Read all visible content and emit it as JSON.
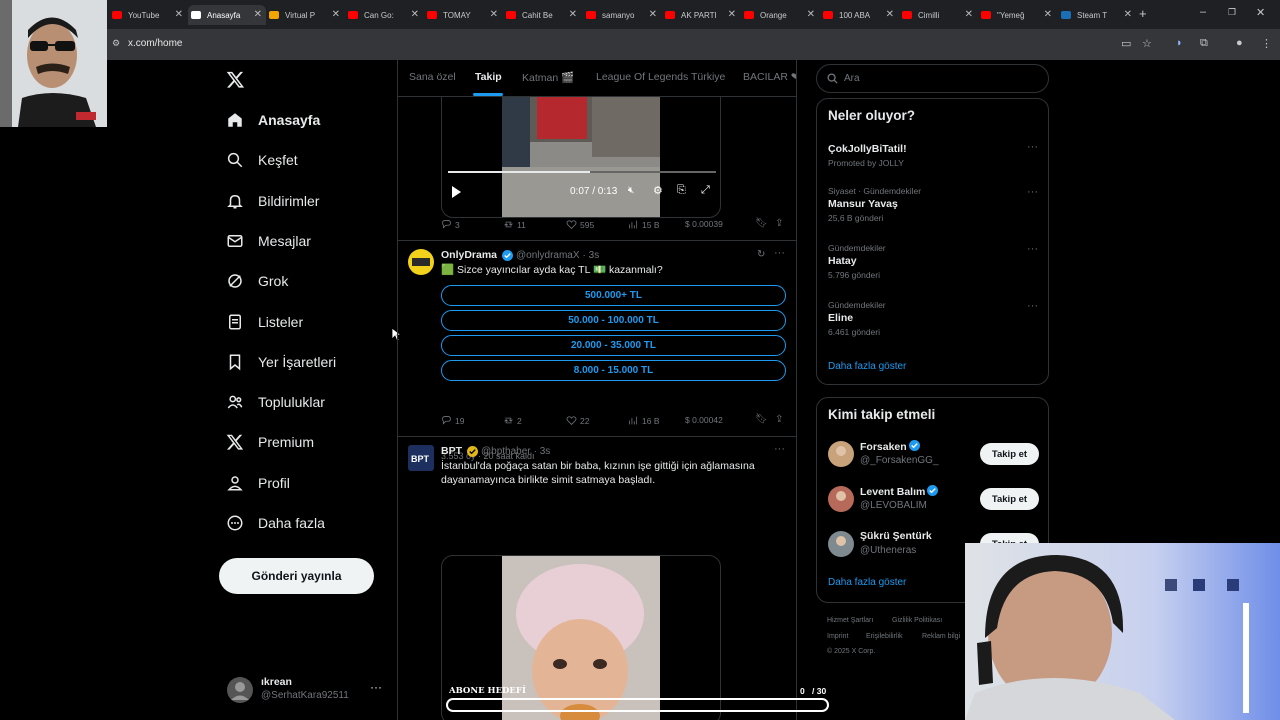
{
  "browser": {
    "tabs": [
      {
        "title": "YouTube",
        "color": "#ff0000"
      },
      {
        "title": "Anasayfa",
        "color": "#ffffff"
      },
      {
        "title": "Virtual P",
        "color": "#f4a400"
      },
      {
        "title": "Can Go:",
        "color": "#ff0000"
      },
      {
        "title": "TOMAY",
        "color": "#ff0000"
      },
      {
        "title": "Cahit Be",
        "color": "#ff0000"
      },
      {
        "title": "samanyo",
        "color": "#ff0000"
      },
      {
        "title": "AK PARTI",
        "color": "#ff0000"
      },
      {
        "title": "Orange",
        "color": "#ff0000"
      },
      {
        "title": "100 ABA",
        "color": "#ff0000"
      },
      {
        "title": "Cimilli",
        "color": "#ff0000"
      },
      {
        "title": "\"Yemeğ",
        "color": "#ff0000"
      },
      {
        "title": "Steam T",
        "color": "#1b6fb5"
      }
    ],
    "url": "x.com/home"
  },
  "nav": {
    "items": [
      {
        "label": "Anasayfa",
        "icon": "home-icon"
      },
      {
        "label": "Keşfet",
        "icon": "search-icon"
      },
      {
        "label": "Bildirimler",
        "icon": "bell-icon"
      },
      {
        "label": "Mesajlar",
        "icon": "mail-icon"
      },
      {
        "label": "Grok",
        "icon": "grok-icon"
      },
      {
        "label": "Listeler",
        "icon": "list-icon"
      },
      {
        "label": "Yer İşaretleri",
        "icon": "bookmark-icon"
      },
      {
        "label": "Topluluklar",
        "icon": "people-icon"
      },
      {
        "label": "Premium",
        "icon": "x-logo-icon"
      },
      {
        "label": "Profil",
        "icon": "person-icon"
      },
      {
        "label": "Daha fazla",
        "icon": "more-circle-icon"
      }
    ],
    "post_button": "Gönderi yayınla",
    "account": {
      "name": "ıkrean",
      "handle": "@SerhatKara92511"
    }
  },
  "feed": {
    "tabs": [
      "Sana özel",
      "Takip",
      "Katman 🎬",
      "League Of Legends Türkiye",
      "BACILAR ❤"
    ],
    "video1": {
      "time": "0:07 / 0:13",
      "progress": 0.53
    },
    "post1_stats": {
      "replies": "3",
      "reposts": "11",
      "likes": "595",
      "views": "15 B",
      "tips": "$ 0.00039"
    },
    "post2": {
      "name": "OnlyDrama",
      "handle": "@onlydramaX",
      "time": "· 3s",
      "text": "🟩 Sizce yayıncılar ayda kaç TL 💵 kazanmalı?",
      "poll": [
        "500.000+ TL",
        "50.000 - 100.000 TL",
        "20.000 - 35.000 TL",
        "8.000 - 15.000 TL"
      ],
      "poll_meta": "3.553 oy · 20 saat kaldı",
      "stats": {
        "replies": "19",
        "reposts": "2",
        "likes": "22",
        "views": "16 B",
        "tips": "$ 0.00042"
      }
    },
    "post3": {
      "name": "BPT",
      "handle": "@bpthaber",
      "time": "· 3s",
      "text": "İstanbul'da poğaça satan bir baba, kızının işe gittiği için ağlamasına dayanamayınca birlikte simit satmaya başladı."
    }
  },
  "overlay": {
    "label": "ABONE HEDEFİ",
    "count": "0",
    "total": "/ 30",
    "progress": 0.0
  },
  "sidebar": {
    "search_placeholder": "Ara",
    "trends_title": "Neler oluyor?",
    "trends": [
      {
        "meta": "",
        "name": "ÇokJollyBiTatil!",
        "count": "Promoted by JOLLY"
      },
      {
        "meta": "Siyaset · Gündemdekiler",
        "name": "Mansur Yavaş",
        "count": "25,6 B gönderi"
      },
      {
        "meta": "Gündemdekiler",
        "name": "Hatay",
        "count": "5.796 gönderi"
      },
      {
        "meta": "Gündemdekiler",
        "name": "Eline",
        "count": "6.461 gönderi"
      }
    ],
    "trends_more": "Daha fazla göster",
    "follow_title": "Kimi takip etmeli",
    "follow": [
      {
        "name": "Forsaken",
        "handle": "@_ForsakenGG_",
        "verified": true
      },
      {
        "name": "Levent Balım",
        "handle": "@LEVOBALIM",
        "verified": true
      },
      {
        "name": "Şükrü Şentürk",
        "handle": "@Utheneras",
        "verified": false
      }
    ],
    "follow_button": "Takip et",
    "follow_more": "Daha fazla göster",
    "footer": [
      "Hizmet Şartları",
      "Gizlilik Politikası",
      "Imprint",
      "Erişilebilirlik",
      "Reklam bilgi",
      "© 2025 X Corp."
    ]
  }
}
